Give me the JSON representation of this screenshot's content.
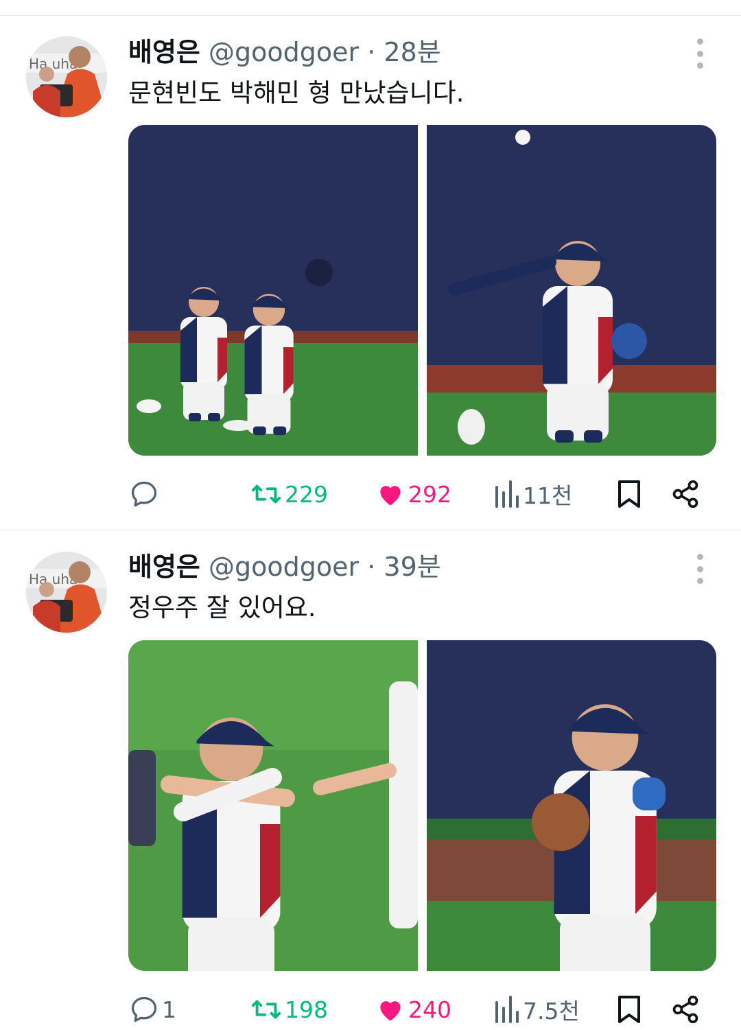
{
  "tweets": [
    {
      "author": "배영은",
      "handle": "@goodgoer",
      "separator": "·",
      "time": "28분",
      "text": "문현빈도 박해민 형 만났습니다.",
      "images": [
        "baseball-players-catching",
        "baseball-player-diving-catch"
      ],
      "metrics": {
        "replies": "",
        "retweets": "229",
        "likes": "292",
        "views": "11천"
      }
    },
    {
      "author": "배영은",
      "handle": "@goodgoer",
      "separator": "·",
      "time": "39분",
      "text": "정우주 잘 있어요.",
      "images": [
        "baseball-player-stretching",
        "baseball-player-with-glove"
      ],
      "metrics": {
        "replies": "1",
        "retweets": "198",
        "likes": "240",
        "views": "7.5천"
      }
    }
  ],
  "colors": {
    "retweet": "#00ba7c",
    "like": "#f91880",
    "secondary_text": "#536471",
    "field_wall": "#27305a",
    "turf": "#3a8a3c"
  },
  "icons": [
    "reply-icon",
    "retweet-icon",
    "like-icon",
    "views-icon",
    "bookmark-icon",
    "share-icon",
    "more-icon"
  ]
}
